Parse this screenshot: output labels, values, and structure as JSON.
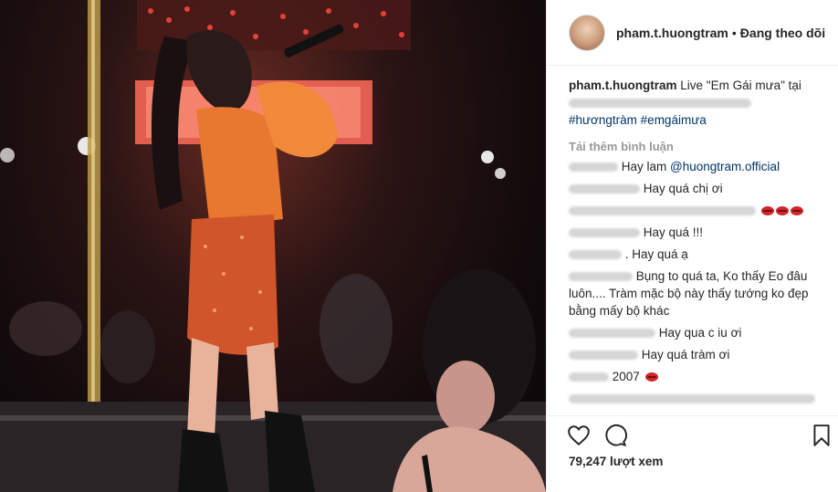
{
  "post": {
    "username": "pham.t.huongtram",
    "separator": "•",
    "follow_status": "Đang theo dõi",
    "caption_text": "Live \"Em Gái mưa\" tại",
    "caption_hashtags": "#hươngtràm #emgáimưa",
    "load_more": "Tải thêm bình luận",
    "views": "79,247 lượt xem"
  },
  "comments": [
    {
      "text": "Hay lam",
      "mention": "@huongtram.official"
    },
    {
      "text": "Hay quá chị ơi"
    },
    {
      "text": ""
    },
    {
      "text": "Hay quá !!!"
    },
    {
      "text": ". Hay quá ạ"
    },
    {
      "text": "Bụng to quá ta, Ko thấy Eo đâu luôn.... Tràm mặc bộ này thấy tướng ko đẹp bằng mấy bộ khác"
    },
    {
      "text": "Hay qua c iu ơi"
    },
    {
      "text": "Hay quá tràm ơi"
    },
    {
      "text": "2007"
    }
  ],
  "icons": {
    "like": "heart-icon",
    "comment": "comment-icon",
    "save": "bookmark-icon",
    "reaction": "lips-emoji-icon"
  },
  "colors": {
    "link": "#003569",
    "muted": "#999999",
    "text": "#262626",
    "lips": "#d0282b"
  }
}
